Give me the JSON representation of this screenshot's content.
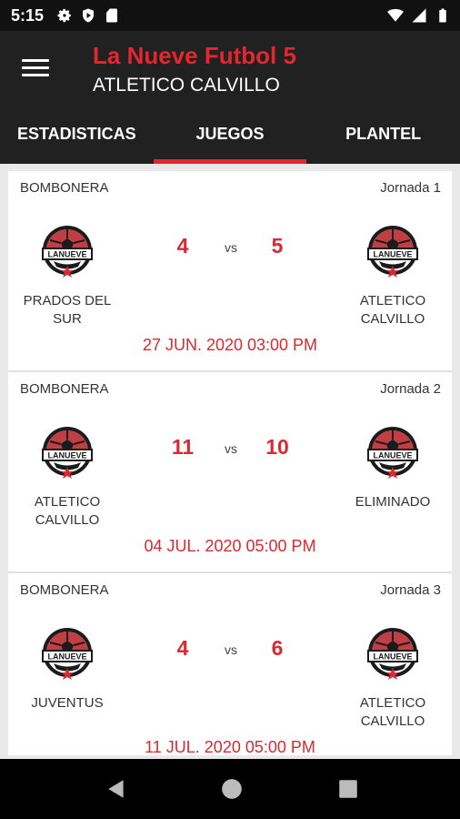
{
  "status_bar": {
    "time": "5:15",
    "left_icons": [
      "settings-icon",
      "shield-icon",
      "sd-card-icon"
    ],
    "right_icons": [
      "wifi-icon",
      "signal-icon",
      "battery-icon"
    ]
  },
  "app_bar": {
    "title": "La Nueve Futbol 5",
    "subtitle": "ATLETICO CALVILLO",
    "menu_icon": "menu-icon"
  },
  "tabs": [
    {
      "label": "ESTADISTICAS",
      "active": false
    },
    {
      "label": "JUEGOS",
      "active": true
    },
    {
      "label": "PLANTEL",
      "active": false
    }
  ],
  "colors": {
    "accent": "#e4262f",
    "score_red": "#d92931",
    "app_bar_bg": "#212121",
    "status_bar_bg": "#111111",
    "list_bg": "#e9e9e9"
  },
  "games": [
    {
      "venue": "BOMBONERA",
      "jornada": "Jornada 1",
      "home_team": "PRADOS DEL SUR",
      "away_team": "ATLETICO CALVILLO",
      "home_score": "4",
      "away_score": "5",
      "vs": "vs",
      "datetime": "27 JUN. 2020 03:00 PM"
    },
    {
      "venue": "BOMBONERA",
      "jornada": "Jornada 2",
      "home_team": "ATLETICO CALVILLO",
      "away_team": "ELIMINADO",
      "home_score": "11",
      "away_score": "10",
      "vs": "vs",
      "datetime": "04 JUL. 2020 05:00 PM"
    },
    {
      "venue": "BOMBONERA",
      "jornada": "Jornada 3",
      "home_team": "JUVENTUS",
      "away_team": "ATLETICO CALVILLO",
      "home_score": "4",
      "away_score": "6",
      "vs": "vs",
      "datetime": "11 JUL. 2020 05:00 PM"
    }
  ],
  "logo_text": "LANUEVE",
  "nav_bar": {
    "buttons": [
      "back-icon",
      "home-icon",
      "recent-apps-icon"
    ]
  }
}
